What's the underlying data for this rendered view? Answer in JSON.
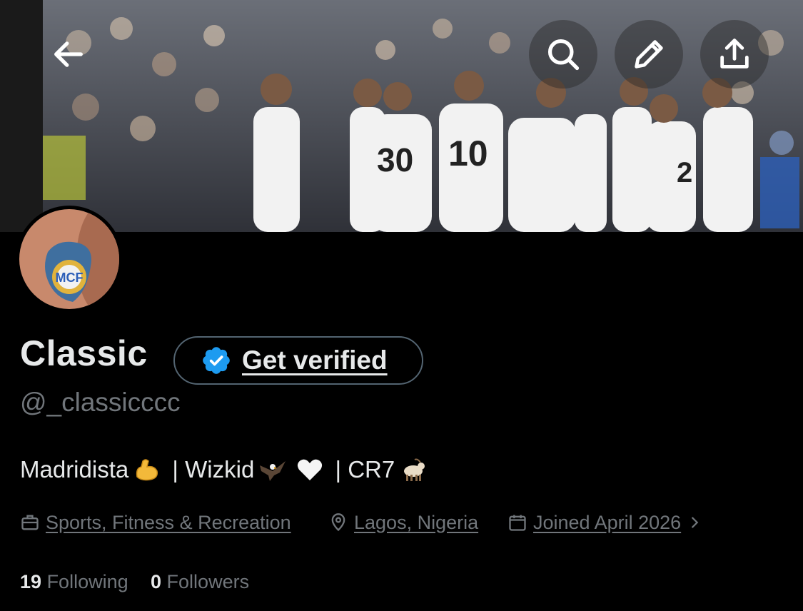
{
  "header": {
    "back_icon": "arrow-left-icon",
    "search_icon": "search-icon",
    "edit_icon": "pencil-icon",
    "share_icon": "share-upload-icon"
  },
  "profile": {
    "name": "Classic",
    "handle": "@_classicccc",
    "verify_label": "Get verified",
    "bio": {
      "part1": "Madridista",
      "part2": " | Wizkid",
      "part3": " | CR7",
      "emojis": [
        "flexed-biceps",
        "eagle",
        "white-heart",
        "goat"
      ]
    },
    "category": "Sports, Fitness & Recreation",
    "location": "Lagos, Nigeria",
    "joined": "Joined April 2026",
    "following_count": "19",
    "following_label": "Following",
    "followers_count": "0",
    "followers_label": "Followers"
  },
  "colors": {
    "background": "#000000",
    "text": "#e7e9ea",
    "muted": "#71767b",
    "verified_blue": "#1d9bf0",
    "border": "#536471"
  }
}
